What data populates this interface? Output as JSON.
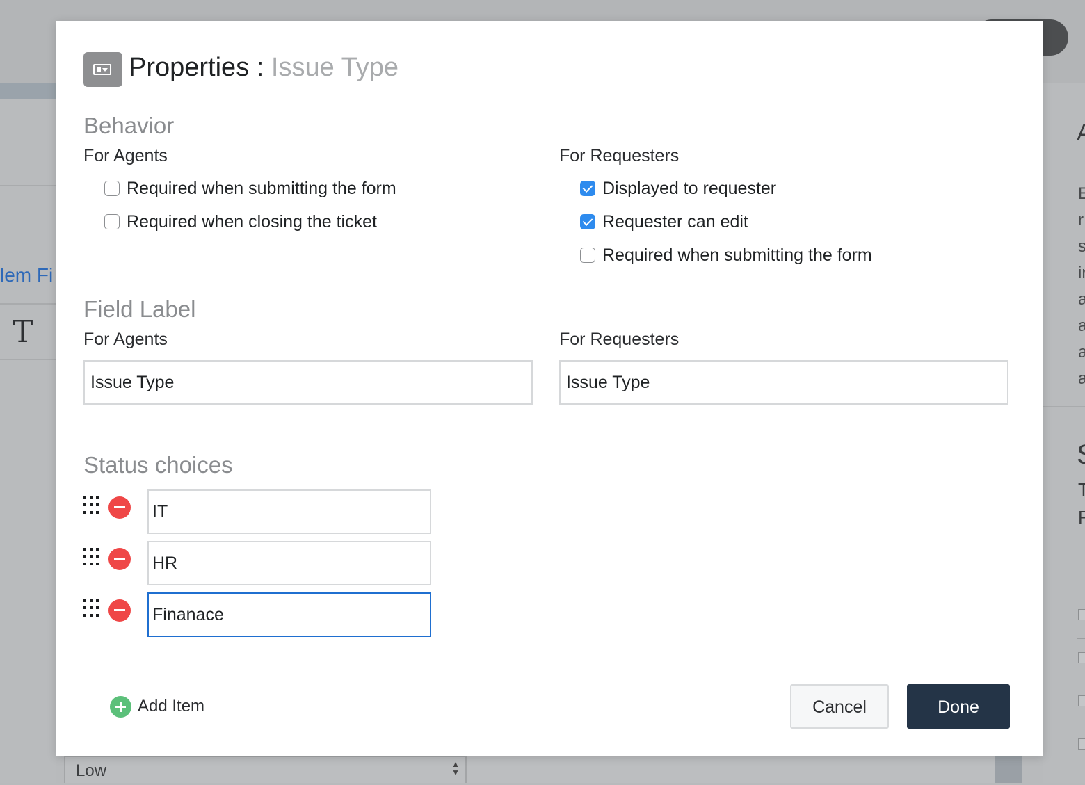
{
  "background": {
    "top_button_label": "",
    "left_link_text": "lem Fi",
    "left_type_glyph": "T",
    "right_letters": [
      "E",
      "r",
      "s",
      "ir",
      "a",
      "a",
      "a",
      "a"
    ],
    "right_heading_letter": "A",
    "right_heading2_letter": "S",
    "right_letters2": [
      "T",
      "F"
    ],
    "select_value": "Low"
  },
  "modal": {
    "title": "Properties",
    "title_separator": " : ",
    "title_field": "Issue Type",
    "behavior": {
      "heading": "Behavior",
      "agents": {
        "heading": "For Agents",
        "options": [
          {
            "label": "Required when submitting the form",
            "checked": false
          },
          {
            "label": "Required when closing the ticket",
            "checked": false
          }
        ]
      },
      "requesters": {
        "heading": "For Requesters",
        "options": [
          {
            "label": "Displayed to requester",
            "checked": true
          },
          {
            "label": "Requester can edit",
            "checked": true
          },
          {
            "label": "Required when submitting the form",
            "checked": false
          }
        ]
      }
    },
    "field_label": {
      "heading": "Field Label",
      "agents_heading": "For Agents",
      "agents_value": "Issue Type",
      "requesters_heading": "For Requesters",
      "requesters_value": "Issue Type"
    },
    "status_choices": {
      "heading": "Status choices",
      "items": [
        "IT",
        "HR",
        "Finanace"
      ]
    },
    "add_item_label": "Add Item",
    "cancel_label": "Cancel",
    "done_label": "Done"
  },
  "colors": {
    "accent_blue": "#2e8bee",
    "remove_red": "#ef4747",
    "add_green": "#5cc07a",
    "done_navy": "#243447",
    "focus_border": "#1f6fd0"
  },
  "icons": {
    "title": "dropdown-field-icon",
    "drag": "drag-handle-icon",
    "remove": "minus-circle-icon",
    "add": "plus-circle-icon"
  }
}
